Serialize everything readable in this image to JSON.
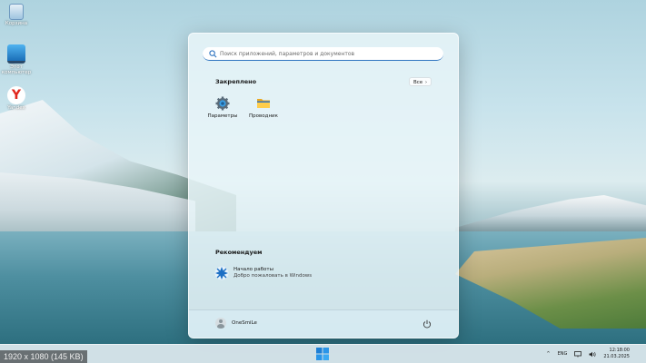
{
  "desktop": {
    "icons": [
      {
        "label": "Корзина",
        "icon": "recycle-bin-icon"
      },
      {
        "label": "Этот компьютер",
        "icon": "this-pc-icon"
      },
      {
        "label": "Yandex",
        "icon": "yandex-browser-icon"
      }
    ]
  },
  "start_menu": {
    "search": {
      "placeholder": "Поиск приложений, параметров и документов",
      "icon": "search-icon"
    },
    "pinned": {
      "title": "Закреплено",
      "all_button": "Все",
      "apps": [
        {
          "label": "Параметры",
          "icon": "settings-gear-icon"
        },
        {
          "label": "Проводник",
          "icon": "file-explorer-folder-icon"
        }
      ]
    },
    "recommended": {
      "title": "Рекомендуем",
      "items": [
        {
          "title": "Начало работы",
          "subtitle": "Добро пожаловать в Windows",
          "icon": "get-started-icon"
        }
      ]
    },
    "footer": {
      "user_name": "OneSmiLe",
      "power_icon": "power-icon"
    }
  },
  "taskbar": {
    "start_icon": "windows-logo-icon",
    "tray": {
      "chevron": "^",
      "language": "ENG",
      "time": "12:18:00",
      "date": "21.03.2025"
    }
  },
  "caption": "1920 x 1080 (145 KB)",
  "colors": {
    "accent": "#2f74c0",
    "start_bg": "#e8f4f8",
    "taskbar_bg": "#dce8ee"
  }
}
